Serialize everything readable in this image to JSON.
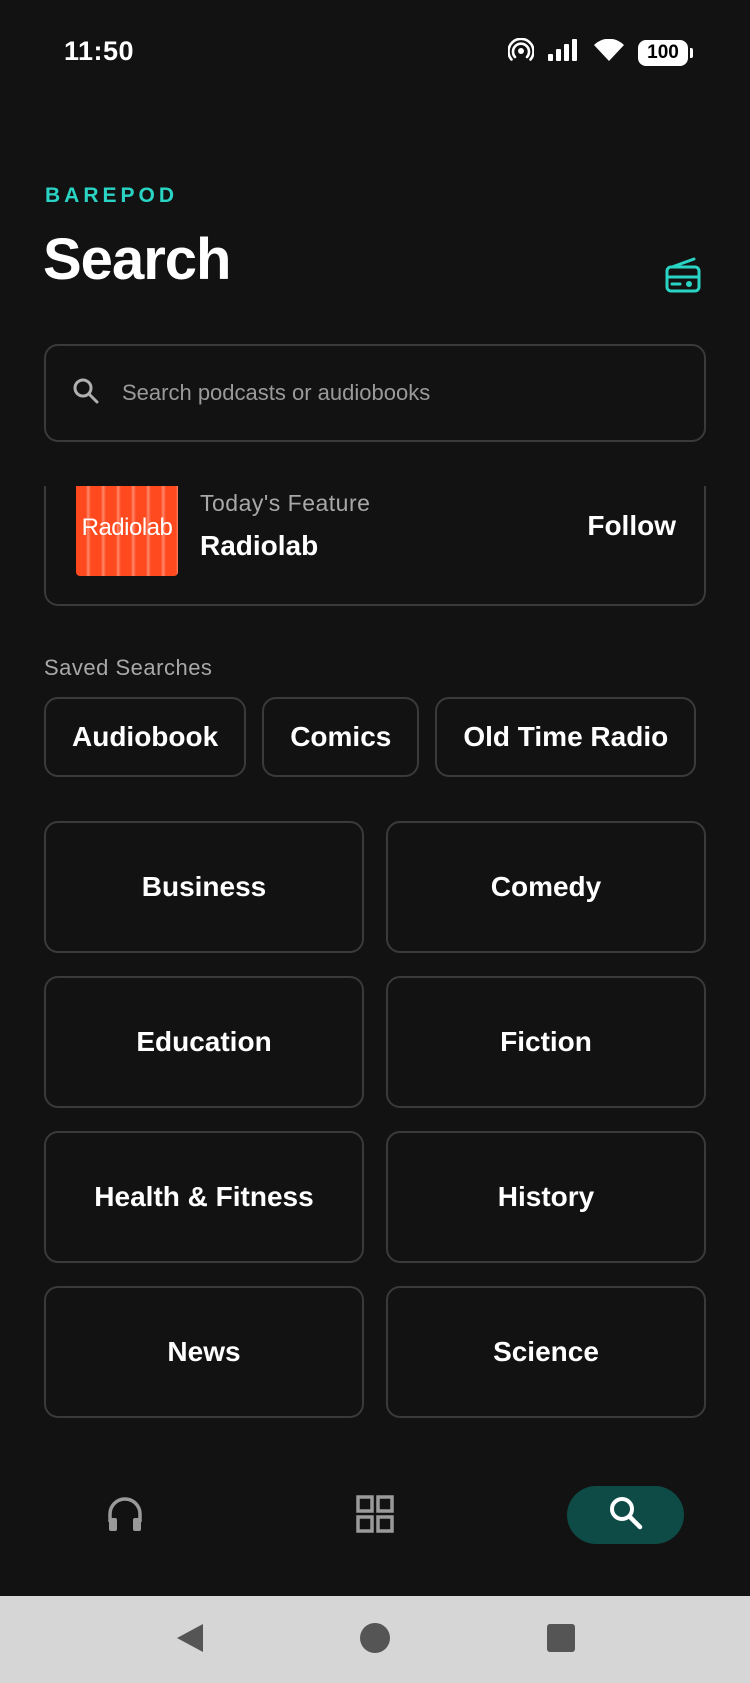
{
  "status_bar": {
    "time": "11:50",
    "battery": "100"
  },
  "header": {
    "brand": "BAREPOD",
    "title": "Search",
    "radio_icon": "radio-icon",
    "accent_color": "#2ad4c4"
  },
  "search": {
    "placeholder": "Search podcasts or audiobooks",
    "value": ""
  },
  "feature": {
    "eyebrow": "Today's Feature",
    "title": "Radiolab",
    "art_text": "Radiolab",
    "follow_label": "Follow",
    "art_color": "#ff4a1f"
  },
  "saved_searches": {
    "label": "Saved Searches",
    "items": [
      "Audiobook",
      "Comics",
      "Old Time Radio"
    ]
  },
  "categories": [
    "Business",
    "Comedy",
    "Education",
    "Fiction",
    "Health & Fitness",
    "History",
    "News",
    "Science"
  ],
  "bottom_nav": {
    "items": [
      {
        "icon": "headphones-icon",
        "active": false
      },
      {
        "icon": "grid-icon",
        "active": false
      },
      {
        "icon": "search-icon",
        "active": true
      }
    ],
    "active_color": "#0e4a46"
  },
  "system_nav": {
    "icons": [
      "back-icon",
      "home-icon",
      "recents-icon"
    ]
  }
}
